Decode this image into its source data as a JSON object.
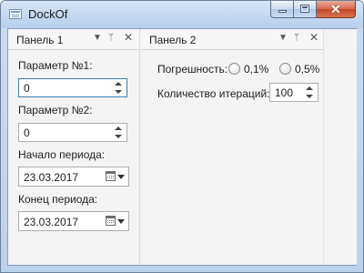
{
  "window": {
    "title": "DockOf",
    "icon": "window-app-icon"
  },
  "caption_buttons": {
    "minimize": "minimize-icon",
    "maximize": "maximize-icon",
    "close": "close-icon"
  },
  "panel1": {
    "title": "Панель 1",
    "header_icons": [
      "dropdown-icon",
      "pin-icon",
      "close-icon"
    ],
    "param1_label": "Параметр №1:",
    "param1_value": "0",
    "param2_label": "Параметр №2:",
    "param2_value": "0",
    "start_label": "Начало периода:",
    "start_value": "23.03.2017",
    "end_label": "Конец периода:",
    "end_value": "23.03.2017"
  },
  "panel2": {
    "title": "Панель 2",
    "header_icons": [
      "dropdown-icon",
      "pin-icon",
      "close-icon"
    ],
    "error_label": "Погрешность:",
    "error_options": [
      "0,1%",
      "0,5%"
    ],
    "iterations_label": "Количество итераций:",
    "iterations_value": "100"
  },
  "colors": {
    "title_bar": "#c3d7ef",
    "close_button": "#c4452b",
    "panel_background": "#f4f4f4",
    "focus_border": "#3d7bad"
  }
}
